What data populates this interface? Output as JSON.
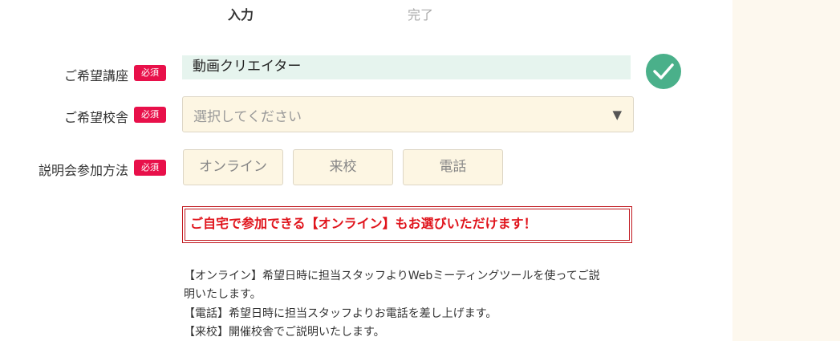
{
  "steps": {
    "input": "入力",
    "complete": "完了"
  },
  "required_label": "必須",
  "course": {
    "label": "ご希望講座",
    "value": "動画クリエイター"
  },
  "school": {
    "label": "ご希望校舎",
    "placeholder": "選択してください"
  },
  "method": {
    "label": "説明会参加方法",
    "options": [
      "オンライン",
      "来校",
      "電話"
    ]
  },
  "notice": "ご自宅で参加できる【オンライン】もお選びいただけます！",
  "info_lines": [
    "【オンライン】希望日時に担当スタッフよりWebミーティングツールを使ってご説",
    "明いたします。",
    "【電話】希望日時に担当スタッフよりお電話を差し上げます。",
    "【来校】開催校舎でご説明いたします。"
  ],
  "colors": {
    "required_badge": "#e8104a",
    "check": "#4ab08a",
    "notice_red": "#e0141c",
    "field_bg": "#fdf6e3",
    "filled_bg": "#e6f4ee"
  }
}
